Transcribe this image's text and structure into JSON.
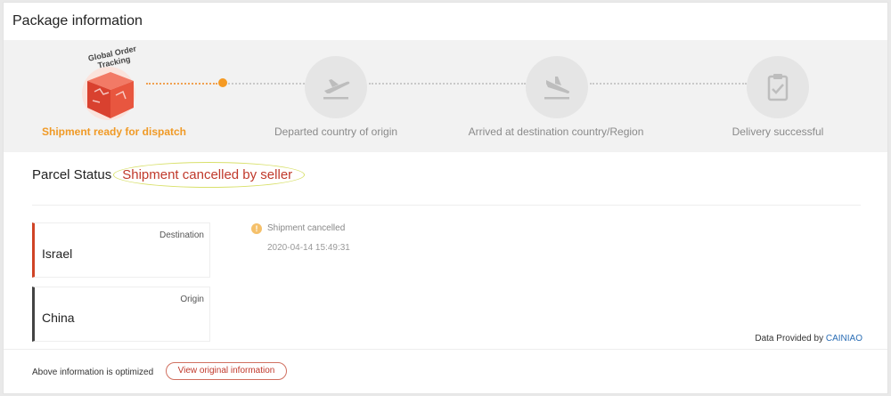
{
  "header": {
    "title": "Package information"
  },
  "tracker": {
    "logo_caption": "Global Order Tracking",
    "steps": [
      {
        "label": "Shipment ready for dispatch",
        "icon": "box-icon",
        "active": true
      },
      {
        "label": "Departed country of origin",
        "icon": "plane-departure-icon",
        "active": false
      },
      {
        "label": "Arrived at destination country/Region",
        "icon": "plane-arrival-icon",
        "active": false
      },
      {
        "label": "Delivery successful",
        "icon": "clipboard-check-icon",
        "active": false
      }
    ],
    "active_color": "#f09a26"
  },
  "parcel": {
    "label": "Parcel Status",
    "status": "Shipment cancelled by seller",
    "status_color": "#c0392b"
  },
  "locations": {
    "destination": {
      "caption": "Destination",
      "name": "Israel"
    },
    "origin": {
      "caption": "Origin",
      "name": "China"
    }
  },
  "events": [
    {
      "text": "Shipment cancelled",
      "time": "2020-04-14 15:49:31"
    }
  ],
  "provider": {
    "prefix": "Data Provided by",
    "name": "CAINIAO"
  },
  "footer": {
    "note": "Above information is optimized",
    "button_label": "View original information"
  }
}
